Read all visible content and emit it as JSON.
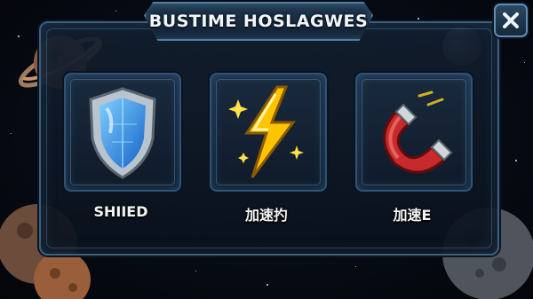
{
  "dialog": {
    "title": "BUSTIME HOSLAGWES",
    "close_label": "✕"
  },
  "powerups": [
    {
      "label": "SHIIED",
      "icon": "shield-icon"
    },
    {
      "label": "加速扚",
      "icon": "lightning-icon"
    },
    {
      "label": "加速E",
      "icon": "magnet-icon"
    }
  ],
  "colors": {
    "panel_border": "#3b5f7d",
    "accent_blue": "#4aa8ff",
    "lightning_yellow": "#ffd21f",
    "magnet_red": "#c8292b"
  }
}
